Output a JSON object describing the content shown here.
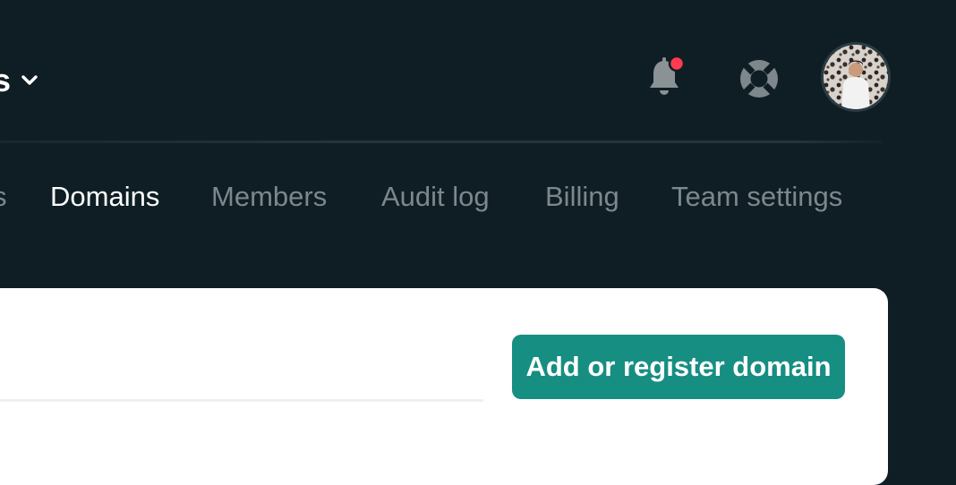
{
  "header": {
    "team_name_fragment": "s",
    "notification_badge_color": "#ff3b4f",
    "icons": {
      "team_menu": "chevron-down-icon",
      "notifications": "bell-icon",
      "help": "lifebuoy-icon",
      "avatar": "user-avatar"
    }
  },
  "nav": {
    "items": [
      {
        "label": "s",
        "active": false
      },
      {
        "label": "Domains",
        "active": true
      },
      {
        "label": "Members",
        "active": false
      },
      {
        "label": "Audit log",
        "active": false
      },
      {
        "label": "Billing",
        "active": false
      },
      {
        "label": "Team settings",
        "active": false
      }
    ]
  },
  "main": {
    "add_domain_label": "Add or register domain",
    "accent_color": "#178e82"
  }
}
